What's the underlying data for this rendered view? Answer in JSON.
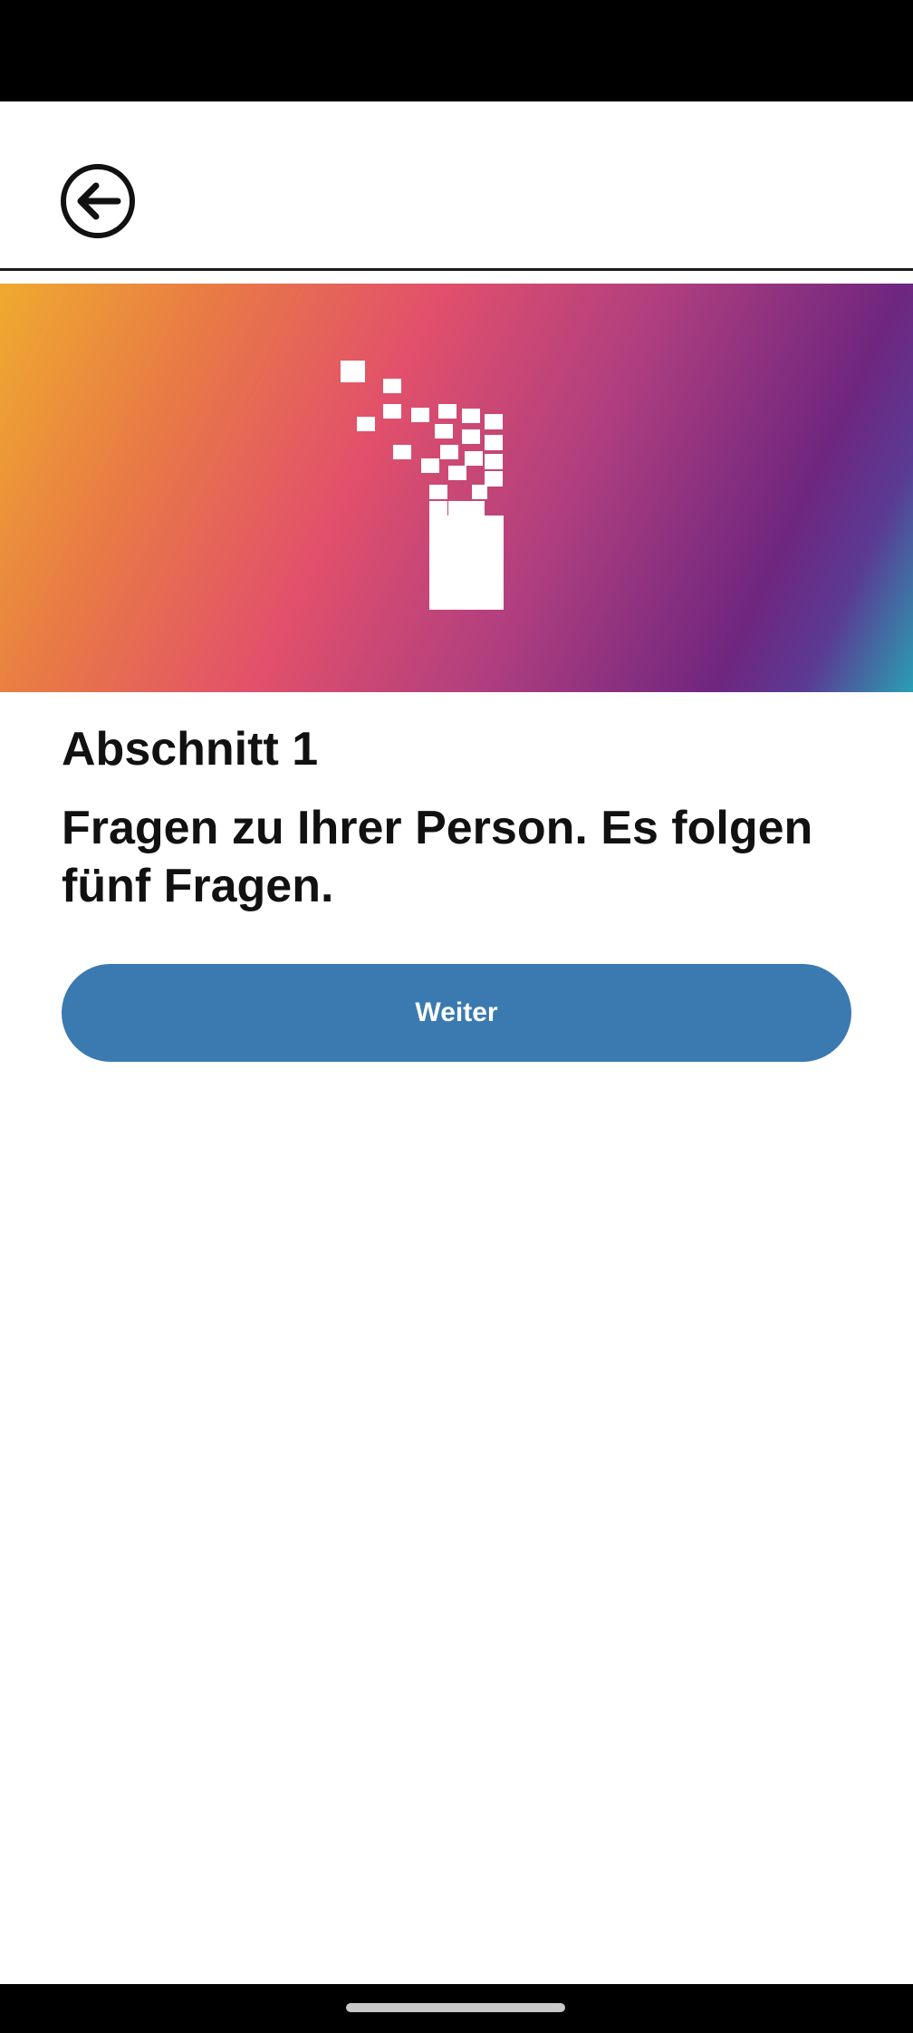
{
  "header": {
    "back_icon": "arrow-left-circle-icon"
  },
  "hero": {
    "logo_icon": "pixel-bars-logo-icon",
    "gradient_colors": [
      "#efaa2f",
      "#e87a45",
      "#e2506b",
      "#b13f7f",
      "#6f267f",
      "#2a9fb2"
    ]
  },
  "content": {
    "section_label": "Abschnitt 1",
    "description": "Fragen zu Ihrer Person. Es folgen fünf Fragen."
  },
  "actions": {
    "continue_label": "Weiter"
  },
  "colors": {
    "primary_button": "#3a7ab0",
    "text": "#111111",
    "background": "#ffffff"
  }
}
